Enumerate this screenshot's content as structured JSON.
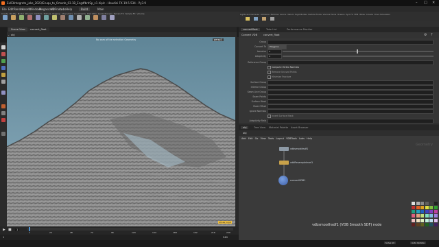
{
  "window": {
    "title": "Ex03Integrate_jake_2023/Eruqu_to_Omonb_03.1B_EngdfbrdSp_v1.hiplc - Houdini FX 19.5.534 - Py3.9"
  },
  "menu": [
    "File",
    "Edit",
    "Render",
    "Assets",
    "Windows",
    "Megascans",
    "VDFram",
    "Labs",
    "Help",
    "Build",
    "Main"
  ],
  "shelf": {
    "left_tabs": [
      "Create",
      "Modify",
      "Model",
      "Polygon",
      "Deform",
      "Texture",
      "Rigging",
      "Characters",
      "Constraints",
      "Hair Utils",
      "Guide Process",
      "Terrain FX",
      "Simple FX",
      "Volume"
    ],
    "right_tabs": [
      "Lights and Cameras",
      "Collisions",
      "Particles",
      "Grains",
      "Vellum",
      "Rigid Bodies",
      "Particle Fluids",
      "Viscous Fluids",
      "Oceans",
      "Pyro FX",
      "FEM",
      "Wires",
      "Crowds",
      "Drive Simulation"
    ]
  },
  "viewport": {
    "tab_label": "Scene View",
    "path_label": "obj",
    "node_label": "convert_float",
    "camera_label": "persp1",
    "overlay_title": "No cam of the selection Geometry",
    "status_text": "stroke input"
  },
  "timeline": {
    "frame": "1",
    "start": "1",
    "end": "240",
    "ticks": [
      "1",
      "24",
      "48",
      "72",
      "96",
      "120",
      "144",
      "168",
      "192",
      "216",
      "240"
    ]
  },
  "params": {
    "tabs": [
      "convertfloat",
      "Take List",
      "Performance Monitor"
    ],
    "node_type": "Convert VDB",
    "node_name": "convert_float",
    "rows": [
      {
        "label": "Group",
        "value": ""
      },
      {
        "label": "Convert To",
        "value": "Polygons"
      },
      {
        "label": "Isovalue",
        "value": "0"
      },
      {
        "label": "Adaptivity",
        "value": "0"
      },
      {
        "label": "Reference Group",
        "value": ""
      },
      {
        "label": "",
        "value": "Compute Vertex Normals"
      },
      {
        "label": "",
        "value": "Remove Unused Points"
      },
      {
        "label": "",
        "value": "Minimize Fracture"
      },
      {
        "label": "Surface Group",
        "value": ""
      },
      {
        "label": "Interior Group",
        "value": ""
      },
      {
        "label": "Seam Line Group",
        "value": ""
      },
      {
        "label": "Seam Points",
        "value": ""
      },
      {
        "label": "Surface Mask",
        "value": ""
      },
      {
        "label": "Mask Offset",
        "value": ""
      },
      {
        "label": "Ignore Normals",
        "value": ""
      },
      {
        "label": "",
        "value": "Invert Surface Mask"
      },
      {
        "label": "Adaptivity Field",
        "value": ""
      }
    ]
  },
  "network": {
    "tabs": [
      "obj",
      "Tree View",
      "Material Palette",
      "Asset Browser"
    ],
    "path": "obj",
    "label": "Geometry",
    "menu": [
      "Add",
      "Edit",
      "Go",
      "View",
      "Tools",
      "Layout",
      "VDBTools",
      "Labs",
      "Help"
    ],
    "nodes": [
      {
        "name": "vdbsmoothsdf1",
        "color": "#8e9aa6"
      },
      {
        "name": "vdbResamplelevel1",
        "color": "#c9a24a"
      },
      {
        "name": "convertVDB1",
        "color": "#3e5fa8"
      }
    ],
    "selection_label": "vdbsmoothsdf1 (VDB Smooth SDF) node"
  },
  "palette": [
    "#e0e0e0",
    "#b0b0b0",
    "#8a8a8a",
    "#606060",
    "#404040",
    "#202020",
    "#c03030",
    "#e06020",
    "#e0a020",
    "#e0e040",
    "#80c040",
    "#30a030",
    "#20a080",
    "#20a0c0",
    "#2060c0",
    "#4040c0",
    "#8040c0",
    "#c040a0",
    "#e06080",
    "#e0a080",
    "#c0e080",
    "#80e0c0",
    "#80c0e0",
    "#a080e0",
    "#f0c0c0",
    "#f0e0c0",
    "#e0f0c0",
    "#c0f0e0",
    "#c0e0f0",
    "#e0c0f0",
    "#602020",
    "#604020",
    "#606020",
    "#206020",
    "#205060",
    "#402060"
  ],
  "status": {
    "right_buttons": [
      "Auto Update",
      "Solve All"
    ]
  },
  "colors": {
    "accent": "#f0b030",
    "viewport_sky": "#7ea0b0"
  }
}
